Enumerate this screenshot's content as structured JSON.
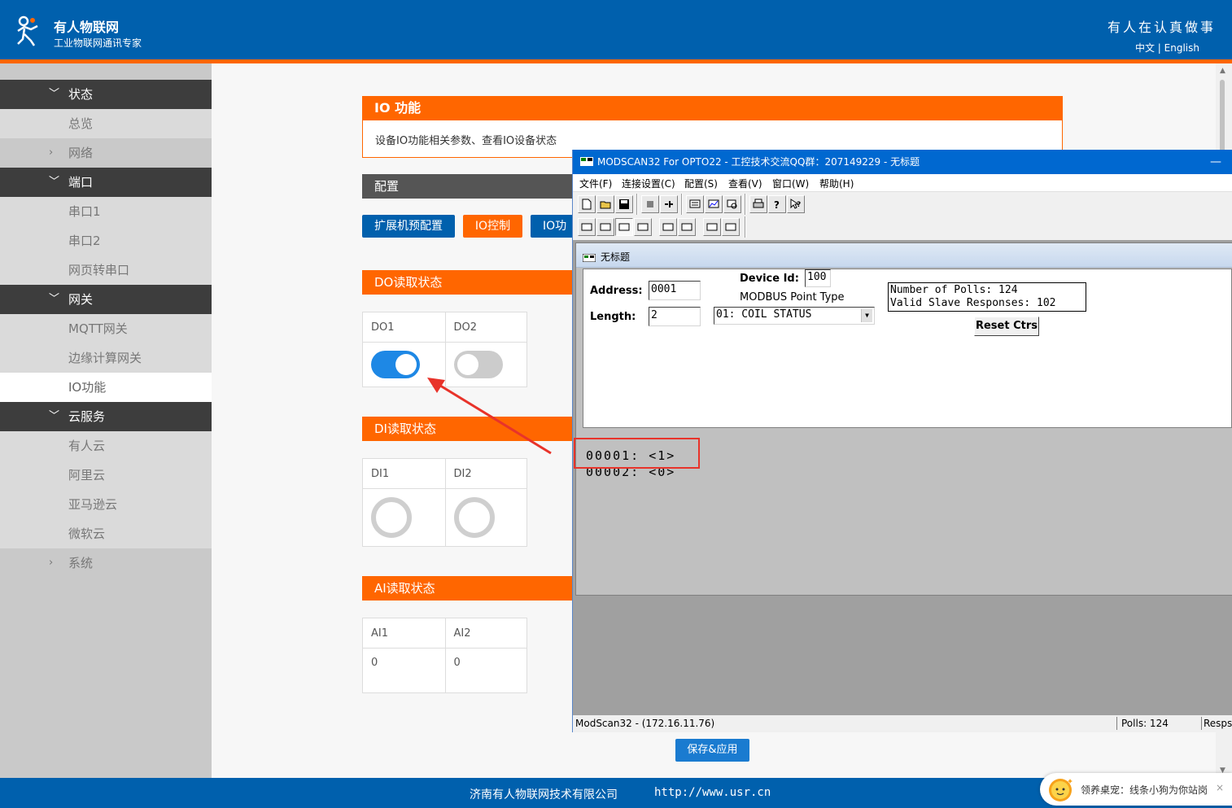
{
  "header": {
    "brand_name": "有人物联网",
    "brand_sub": "工业物联网通讯专家",
    "slogan": "有人在认真做事",
    "lang_cn": "中文",
    "lang_sep": "|",
    "lang_en": "English"
  },
  "sidebar": {
    "groups": [
      {
        "label": "状态",
        "items": [
          "总览"
        ]
      },
      {
        "label": "网络"
      },
      {
        "label": "端口",
        "items": [
          "串口1",
          "串口2",
          "网页转串口"
        ]
      },
      {
        "label": "网关",
        "items": [
          "MQTT网关",
          "边缘计算网关",
          "IO功能"
        ]
      },
      {
        "label": "云服务",
        "items": [
          "有人云",
          "阿里云",
          "亚马逊云",
          "微软云"
        ]
      },
      {
        "label": "系统"
      }
    ]
  },
  "main": {
    "io_title": "IO 功能",
    "io_desc": "设备IO功能相关参数、查看IO设备状态",
    "config_title": "配置",
    "tabs": [
      "扩展机预配置",
      "IO控制",
      "IO功能"
    ],
    "do": {
      "title": "DO读取状态",
      "cols": [
        "DO1",
        "DO2"
      ],
      "states": [
        true,
        false
      ]
    },
    "di": {
      "title": "DI读取状态",
      "cols": [
        "DI1",
        "DI2"
      ]
    },
    "ai": {
      "title": "AI读取状态",
      "cols": [
        "AI1",
        "AI2"
      ],
      "values": [
        "0",
        "0"
      ]
    },
    "save_label": "保存&应用"
  },
  "footer": {
    "company": "济南有人物联网技术有限公司",
    "site": "http://www.usr.cn"
  },
  "notification": {
    "text": "领养桌宠：线条小狗为你站岗",
    "close": "×"
  },
  "modscan": {
    "title": "MODSCAN32 For OPTO22 - 工控技术交流QQ群：207149229 - 无标题",
    "min": "—",
    "menu": [
      "文件(F)",
      "连接设置(C)",
      "配置(S)",
      "查看(V)",
      "窗口(W)",
      "帮助(H)"
    ],
    "doc_title": "无标题",
    "address_label": "Address:",
    "address_value": "0001",
    "length_label": "Length:",
    "length_value": "2",
    "device_id_label": "Device Id:",
    "device_id_value": "100",
    "point_type_label": "MODBUS Point Type",
    "point_type_value": "01: COIL STATUS",
    "stats_polls": "Number of Polls: 124",
    "stats_valid": "Valid Slave Responses: 102",
    "reset_label": "Reset Ctrs",
    "rows": [
      "00001:  <1>",
      "00002:  <0>"
    ],
    "status_left": "ModScan32 - (172.16.11.76)",
    "status_polls": "Polls: 124",
    "status_resp": "Resps"
  },
  "colors": {
    "brand_blue": "#0060ad",
    "accent_orange": "#ff6600",
    "toggle_on": "#1e88e5",
    "toggle_off": "#cccccc"
  }
}
